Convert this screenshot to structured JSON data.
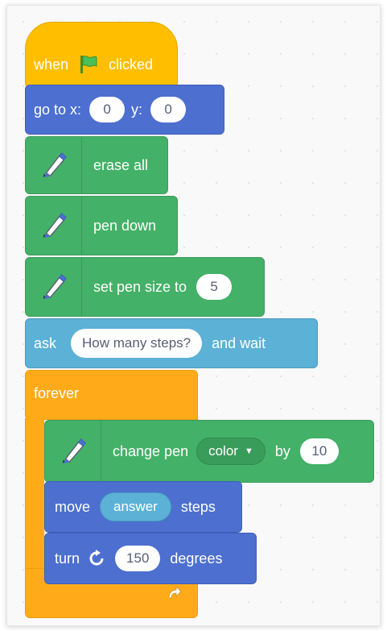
{
  "script": {
    "when_flag_clicked": {
      "when": "when",
      "clicked": "clicked"
    },
    "go_to": {
      "label_x": "go to x:",
      "x": "0",
      "label_y": "y:",
      "y": "0"
    },
    "erase_all": {
      "label": "erase all"
    },
    "pen_down": {
      "label": "pen down"
    },
    "set_pen_size": {
      "label": "set pen size to",
      "value": "5"
    },
    "ask": {
      "label": "ask",
      "question": "How many steps?",
      "suffix": "and wait"
    },
    "forever": {
      "label": "forever"
    },
    "change_pen": {
      "label": "change pen",
      "param": "color",
      "by": "by",
      "value": "10"
    },
    "move": {
      "label": "move",
      "reporter": "answer",
      "suffix": "steps"
    },
    "turn": {
      "label": "turn",
      "value": "150",
      "suffix": "degrees"
    }
  },
  "icons": {
    "flag": "green-flag-icon",
    "pen": "pen-extension-icon",
    "turn": "rotate-clockwise-icon",
    "loop": "loop-arrow-icon",
    "dropdown": "dropdown-caret-icon"
  },
  "colors": {
    "events": "#ffbf00",
    "motion": "#4c6fd0",
    "pen": "#43b167",
    "sensing": "#5cb1d6",
    "control": "#ffab19"
  }
}
